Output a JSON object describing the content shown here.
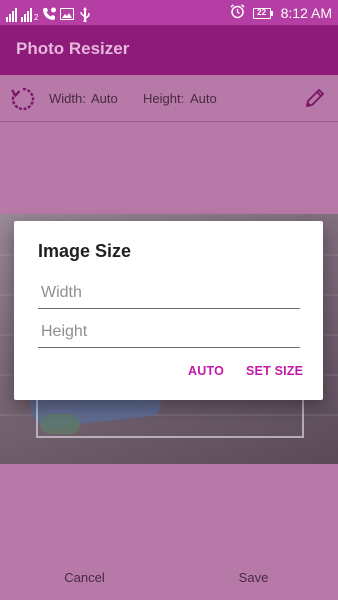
{
  "status_bar": {
    "sim2": "2",
    "battery": "22",
    "time": "8:12 AM"
  },
  "app": {
    "title": "Photo Resizer"
  },
  "toolbar": {
    "width_label": "Width:",
    "width_value": "Auto",
    "height_label": "Height:",
    "height_value": "Auto"
  },
  "bottom": {
    "cancel": "Cancel",
    "save": "Save"
  },
  "dialog": {
    "title": "Image Size",
    "width_placeholder": "Width",
    "height_placeholder": "Height",
    "auto_button": "AUTO",
    "set_size_button": "SET SIZE"
  },
  "colors": {
    "status_bar": "#b43ea3",
    "app_bar": "#8e1a7a",
    "accent": "#c21aa6",
    "toolbar": "#b779a8"
  }
}
